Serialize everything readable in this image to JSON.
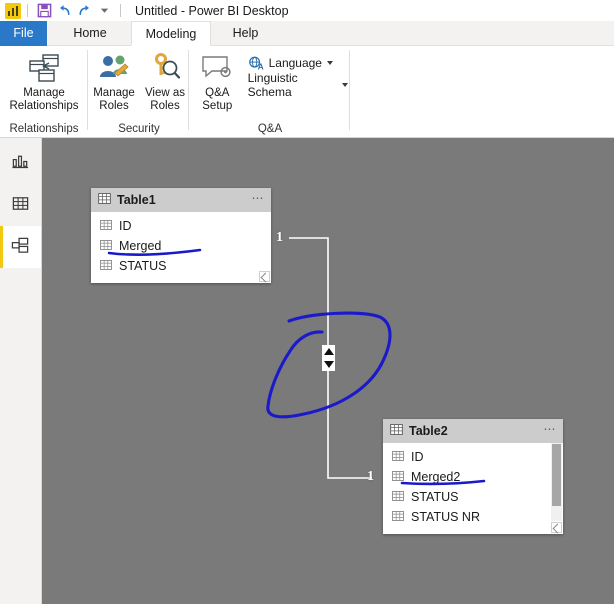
{
  "titlebar": {
    "app_icon": "powerbi-logo-icon",
    "save_icon": "save-icon",
    "undo_icon": "undo-icon",
    "redo_icon": "redo-icon",
    "customize_qat_icon": "chevron-down-icon",
    "title": "Untitled - Power BI Desktop"
  },
  "tabs": [
    {
      "label": "File",
      "active": false,
      "style": "file"
    },
    {
      "label": "Home",
      "active": false,
      "style": "plain"
    },
    {
      "label": "Modeling",
      "active": true,
      "style": "active"
    },
    {
      "label": "Help",
      "active": false,
      "style": "plain"
    }
  ],
  "ribbon": {
    "groups": [
      {
        "name": "Relationships",
        "label": "Relationships",
        "buttons": [
          {
            "label": "Manage\nRelationships",
            "icon": "manage-relationships-icon"
          }
        ]
      },
      {
        "name": "Security",
        "label": "Security",
        "buttons": [
          {
            "label": "Manage\nRoles",
            "icon": "manage-roles-icon"
          },
          {
            "label": "View as\nRoles",
            "icon": "view-as-roles-icon"
          }
        ]
      },
      {
        "name": "Q&A",
        "label": "Q&A",
        "buttons": [
          {
            "label": "Q&A\nSetup",
            "icon": "qa-setup-icon"
          }
        ],
        "menus": [
          {
            "label": "Language",
            "icon": "language-icon",
            "has_caret": true
          },
          {
            "label": "Linguistic Schema",
            "icon": "",
            "has_caret": true
          }
        ]
      }
    ]
  },
  "leftnav": {
    "items": [
      {
        "name": "report-view",
        "icon": "bar-chart-icon",
        "selected": false
      },
      {
        "name": "data-view",
        "icon": "table-grid-icon",
        "selected": false
      },
      {
        "name": "model-view",
        "icon": "model-relationships-icon",
        "selected": true
      }
    ]
  },
  "canvas": {
    "background_color": "#7a7a7a",
    "tables": [
      {
        "name": "Table1",
        "icon": "table-icon",
        "menu_icon": "more-options-icon",
        "fields": [
          {
            "label": "ID",
            "icon": "field-table-icon",
            "annotated": false
          },
          {
            "label": "Merged",
            "icon": "field-table-icon",
            "annotated": true
          },
          {
            "label": "STATUS",
            "icon": "field-table-icon",
            "annotated": false
          }
        ],
        "has_scrollbar": false
      },
      {
        "name": "Table2",
        "icon": "table-icon",
        "menu_icon": "more-options-icon",
        "fields": [
          {
            "label": "ID",
            "icon": "field-table-icon",
            "annotated": false
          },
          {
            "label": "Merged2",
            "icon": "field-table-icon",
            "annotated": true
          },
          {
            "label": "STATUS",
            "icon": "field-table-icon",
            "annotated": false
          },
          {
            "label": "STATUS NR",
            "icon": "field-table-icon",
            "annotated": false
          }
        ],
        "has_scrollbar": true
      }
    ],
    "relationship": {
      "cardinality_start": "1",
      "cardinality_end": "1",
      "cross_filter_icon": "bidirectional-filter-icon",
      "line_color": "#ffffff"
    },
    "annotations": {
      "ink_color": "#1a1acb",
      "lasso_name": "ink-lasso-circle",
      "underline_table1_field": "Merged",
      "underline_table2_field": "Merged2"
    }
  }
}
